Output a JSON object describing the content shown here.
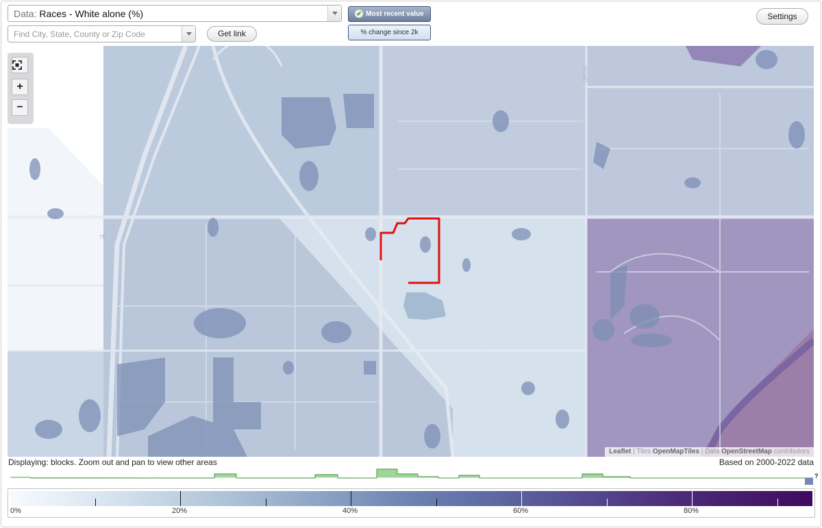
{
  "toolbar": {
    "data_prefix": "Data:",
    "data_value": "Races - White alone (%)",
    "search_placeholder": "Find City, State, County or Zip Code",
    "get_link_label": "Get link",
    "most_recent_label": "Most recent value",
    "pct_change_label": "% change since 2k",
    "settings_label": "Settings",
    "icons": {
      "dropdown": "chevron-down-icon",
      "check": "check-icon"
    }
  },
  "map": {
    "zoom_controls": {
      "fullscreen_icon": "fullscreen-icon",
      "zoom_in": "+",
      "zoom_out": "−"
    },
    "road_labels": {
      "road": "ROAD",
      "route": "75"
    },
    "attribution": {
      "leaflet": "Leaflet",
      "tiles_prefix": " | Tiles ",
      "tiles": "OpenMapTiles",
      "data_prefix": " | Data ",
      "data": "OpenStreetMap",
      "suffix": " contributors"
    },
    "colors": {
      "highlight_outline": "#e01010",
      "low": "#f7fbff",
      "mid": "#c8d3e3",
      "high": "#8f7eb0"
    }
  },
  "status": {
    "displaying": "Displaying: blocks. Zoom out and pan to view other areas",
    "based_on": "Based on 2000-2022 data",
    "histogram_marker": "?"
  },
  "legend": {
    "labels": [
      "0%",
      "20%",
      "40%",
      "60%",
      "80%"
    ],
    "range": [
      0,
      94
    ]
  }
}
